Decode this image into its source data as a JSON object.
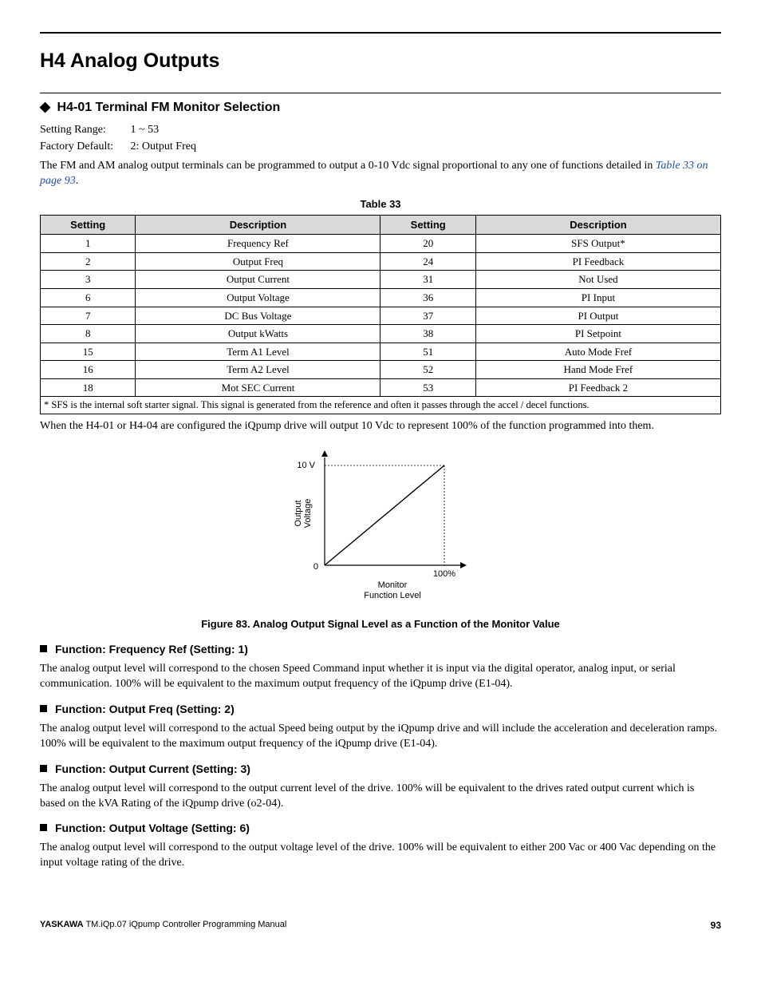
{
  "header": {
    "title": "H4 Analog Outputs"
  },
  "section": {
    "title": "H4-01 Terminal FM Monitor Selection",
    "setting_range_label": "Setting Range:",
    "setting_range_value": "1 ~ 53",
    "factory_default_label": "Factory Default:",
    "factory_default_value": "2: Output Freq",
    "intro_pre": "The FM and AM analog output terminals can be programmed to output a 0-10 Vdc signal proportional to any one of functions detailed in ",
    "intro_link": "Table 33 on page 93",
    "intro_post": ".",
    "after_table": "When the H4-01 or H4-04 are configured the iQpump drive will output 10 Vdc to represent 100% of the function programmed into them."
  },
  "table33": {
    "caption": "Table 33",
    "headers": [
      "Setting",
      "Description",
      "Setting",
      "Description"
    ],
    "rows": [
      [
        "1",
        "Frequency Ref",
        "20",
        "SFS Output*"
      ],
      [
        "2",
        "Output Freq",
        "24",
        "PI Feedback"
      ],
      [
        "3",
        "Output Current",
        "31",
        "Not Used"
      ],
      [
        "6",
        "Output Voltage",
        "36",
        "PI Input"
      ],
      [
        "7",
        "DC Bus Voltage",
        "37",
        "PI Output"
      ],
      [
        "8",
        "Output kWatts",
        "38",
        "PI Setpoint"
      ],
      [
        "15",
        "Term A1 Level",
        "51",
        "Auto Mode Fref"
      ],
      [
        "16",
        "Term A2 Level",
        "52",
        "Hand Mode Fref"
      ],
      [
        "18",
        "Mot SEC Current",
        "53",
        "PI Feedback 2"
      ]
    ],
    "footnote": "* SFS is the internal soft starter signal. This signal is generated from the reference and often it passes through the accel / decel functions."
  },
  "chart_data": {
    "type": "line",
    "x": [
      0,
      100
    ],
    "values": [
      0,
      10
    ],
    "xlabel": "Monitor Function Level",
    "ylabel": "Output Voltage",
    "ylim": [
      0,
      10
    ],
    "xlim": [
      0,
      100
    ],
    "ytick_labels": [
      "0",
      "10 V"
    ],
    "xtick_labels": [
      "",
      "100%"
    ]
  },
  "figure": {
    "ytop": "10 V",
    "yzero": "0",
    "xmax": "100%",
    "ylabel1": "Output",
    "ylabel2": "Voltage",
    "xlabel1": "Monitor",
    "xlabel2": "Function Level",
    "caption": "Figure 83.  Analog Output Signal Level as a Function of the Monitor Value"
  },
  "functions": [
    {
      "title": "Function: Frequency Ref (Setting: 1)",
      "body": "The analog output level will correspond to the chosen Speed Command input whether it is input via the digital operator, analog input, or serial communication. 100% will be equivalent to the maximum output frequency of the iQpump drive (E1-04)."
    },
    {
      "title": "Function: Output Freq (Setting: 2)",
      "body": "The analog output level will correspond to the actual Speed being output by the iQpump drive and will include the acceleration and deceleration ramps. 100% will be equivalent to the maximum output frequency of the iQpump drive (E1-04)."
    },
    {
      "title": "Function: Output Current (Setting: 3)",
      "body": "The analog output level will correspond to the output current level of the drive. 100% will be equivalent to the drives rated output current which is based on the kVA Rating of the iQpump drive (o2-04)."
    },
    {
      "title": "Function: Output Voltage (Setting: 6)",
      "body": "The analog output level will correspond to the output voltage level of the drive. 100% will be equivalent to either 200 Vac or 400 Vac depending on the input voltage rating of the drive."
    }
  ],
  "footer": {
    "brand": "YASKAWA",
    "doc": " TM.iQp.07 iQpump Controller Programming Manual",
    "page": "93"
  }
}
